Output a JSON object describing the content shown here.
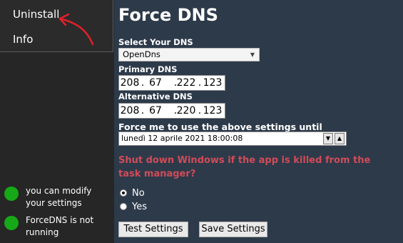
{
  "menu": {
    "uninstall": "Uninstall",
    "info": "Info"
  },
  "status": [
    {
      "text": "you can modify your settings",
      "color": "#17a817"
    },
    {
      "text": "ForceDNS is not running",
      "color": "#17a817"
    }
  ],
  "main": {
    "title": "Force DNS",
    "select_label": "Select Your DNS",
    "selected_dns": "OpenDns",
    "primary_label": "Primary DNS",
    "primary": [
      "208",
      "67",
      "222",
      "123"
    ],
    "alt_label": "Alternative DNS",
    "alternative": [
      "208",
      "67",
      "220",
      "123"
    ],
    "until_label": "Force me to use the above settings until",
    "until_value": "lunedì 12 aprile 2021 18:00:08",
    "shutdown_question": "Shut down Windows if the app is killed from the task manager?",
    "radio_no": "No",
    "radio_yes": "Yes",
    "radio_selected": "No",
    "test_button": "Test Settings",
    "save_button": "Save Settings"
  },
  "colors": {
    "accent_red": "#d24b58",
    "status_green": "#17a817",
    "background": "#2d3a4a"
  }
}
